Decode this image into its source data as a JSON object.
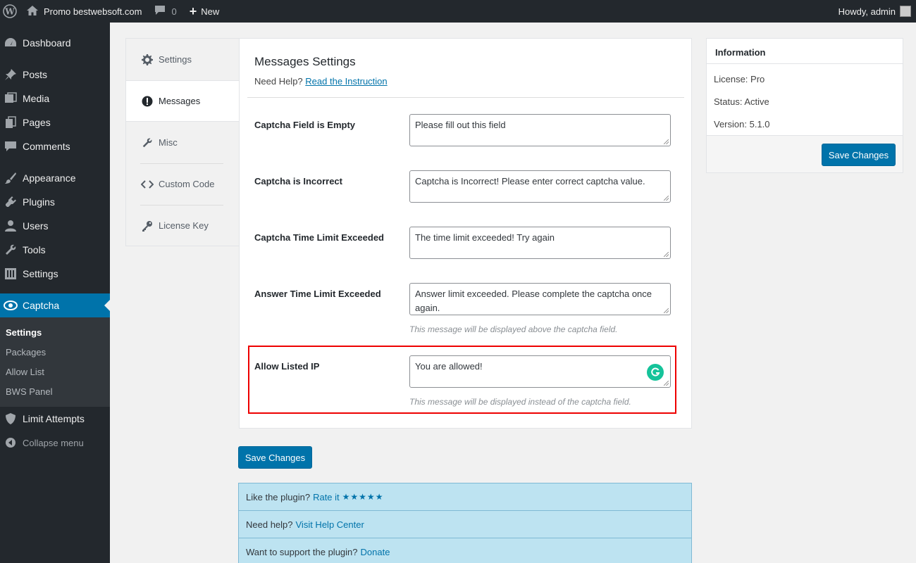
{
  "adminbar": {
    "site_name": "Promo bestwebsoft.com",
    "comment_count": "0",
    "new_label": "New",
    "howdy": "Howdy, admin"
  },
  "sidebar": {
    "items": [
      {
        "label": "Dashboard",
        "icon": "dashboard-icon"
      },
      {
        "label": "Posts",
        "icon": "pin-icon"
      },
      {
        "label": "Media",
        "icon": "media-icon"
      },
      {
        "label": "Pages",
        "icon": "pages-icon"
      },
      {
        "label": "Comments",
        "icon": "comment-icon"
      },
      {
        "label": "Appearance",
        "icon": "brush-icon"
      },
      {
        "label": "Plugins",
        "icon": "plug-icon"
      },
      {
        "label": "Users",
        "icon": "user-icon"
      },
      {
        "label": "Tools",
        "icon": "wrench-icon"
      },
      {
        "label": "Settings",
        "icon": "sliders-icon"
      },
      {
        "label": "Captcha",
        "icon": "captcha-icon"
      },
      {
        "label": "Limit Attempts",
        "icon": "shield-icon"
      },
      {
        "label": "Collapse menu",
        "icon": "collapse-icon"
      }
    ],
    "submenu": [
      "Settings",
      "Packages",
      "Allow List",
      "BWS Panel"
    ]
  },
  "tabs": [
    "Settings",
    "Messages",
    "Misc",
    "Custom Code",
    "License Key"
  ],
  "panel": {
    "title": "Messages Settings",
    "help_text": "Need Help?",
    "help_link": "Read the Instruction",
    "rows": [
      {
        "label": "Captcha Field is Empty",
        "value": "Please fill out this field"
      },
      {
        "label": "Captcha is Incorrect",
        "value": "Captcha is Incorrect! Please enter correct captcha value."
      },
      {
        "label": "Captcha Time Limit Exceeded",
        "value": "The time limit exceeded! Try again"
      },
      {
        "label": "Answer Time Limit Exceeded",
        "value": "Answer limit exceeded. Please complete the captcha once again.",
        "hint": "This message will be displayed above the captcha field."
      },
      {
        "label": "Allow Listed IP",
        "value": "You are allowed!",
        "hint": "This message will be displayed instead of the captcha field."
      }
    ]
  },
  "save_label": "Save Changes",
  "info": {
    "title": "Information",
    "license_label": "License:",
    "license_value": "Pro",
    "status_label": "Status:",
    "status_value": "Active",
    "version_label": "Version:",
    "version_value": "5.1.0"
  },
  "promo": {
    "rate_text": "Like the plugin?",
    "rate_link": "Rate it",
    "stars": "★★★★★",
    "help_text": "Need help?",
    "help_link": "Visit Help Center",
    "support_text": "Want to support the plugin?",
    "support_link": "Donate"
  },
  "colors": {
    "accent": "#0073aa",
    "sidebar_bg": "#23282d",
    "highlight": "#e00000",
    "promo_bg": "#bde3f1"
  }
}
